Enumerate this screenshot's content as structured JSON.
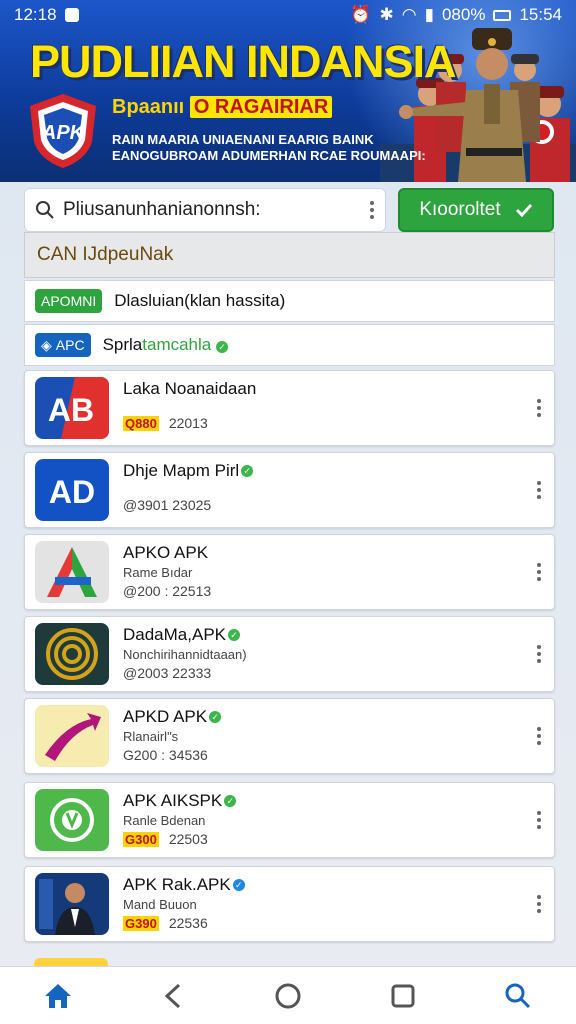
{
  "status_bar": {
    "time": "12:18",
    "battery": "080%",
    "clock_right": "15:54"
  },
  "banner": {
    "title": "PUDLIIAN INDANSIA",
    "subtitle": "Bpaanıı",
    "subtitle_highlight": "O RAGAIRIAR",
    "line1": "RAIN MAARIA UNIAENANI EAARIG  BAINK",
    "line2": "EANOGUBROAM ADUMERHAN RCAE ROUMAAPI:",
    "shield_text": "APK"
  },
  "search": {
    "value": "Pliusanunhanianonnsh:"
  },
  "search_button": {
    "label": "Kıooroltet"
  },
  "section": {
    "label": "CAN IJdpeuNak"
  },
  "filters": [
    {
      "chip": "APOMNI",
      "text": "Dlasluian(klan hassita)",
      "chip_color": "#2ea43f"
    },
    {
      "chip": "APC",
      "text": "Sprlа",
      "text_green": "tamcahla",
      "chip_color": "#1565c0"
    }
  ],
  "apps": [
    {
      "title": "Laka Noanaidaan",
      "sub": "",
      "badge": "Q880",
      "meta": "22013",
      "verified": false,
      "icon": "apk-blue-red-icon"
    },
    {
      "title": "Dhje Mapm Pirl",
      "sub": "",
      "badge": "",
      "meta": "@3901 23025",
      "verified": true,
      "icon": "ad-blue-icon"
    },
    {
      "title": "APKO APK",
      "sub": "Rame Bıdar",
      "badge": "",
      "meta": "@200 : 22513",
      "verified": false,
      "icon": "triangle-a-icon"
    },
    {
      "title": "DadaMa,APK",
      "sub": "Nonchirihannidtaaan)",
      "badge": "",
      "meta": "@2003 22333",
      "verified": true,
      "icon": "spiral-gold-icon"
    },
    {
      "title": "APKD APK",
      "sub": "Rlanairl\"s",
      "badge": "",
      "meta": "G200 : 34536",
      "verified": true,
      "icon": "purple-arrow-icon"
    },
    {
      "title": "APK AIKSPK",
      "sub": "Ranle Bdenan",
      "badge": "G300",
      "meta": "22503",
      "verified": true,
      "icon": "green-shield-icon"
    },
    {
      "title": "APK Rak.APK",
      "sub": "Mand Buuon",
      "badge": "G390",
      "meta": "22536",
      "verified": true,
      "icon": "person-portrait-icon"
    }
  ],
  "nav": [
    "home-icon",
    "back-icon",
    "circle-home-icon",
    "square-recents-icon",
    "search-icon"
  ]
}
